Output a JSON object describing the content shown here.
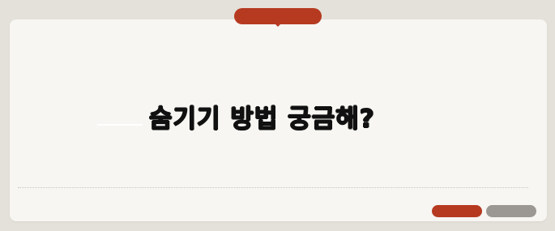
{
  "headline": {
    "text": "숨기기 방법 궁금해?"
  },
  "colors": {
    "accent": "#b63a20",
    "secondary": "#9b9894",
    "card": "#f7f6f2",
    "background": "#e3e1d9",
    "text": "#111111"
  }
}
